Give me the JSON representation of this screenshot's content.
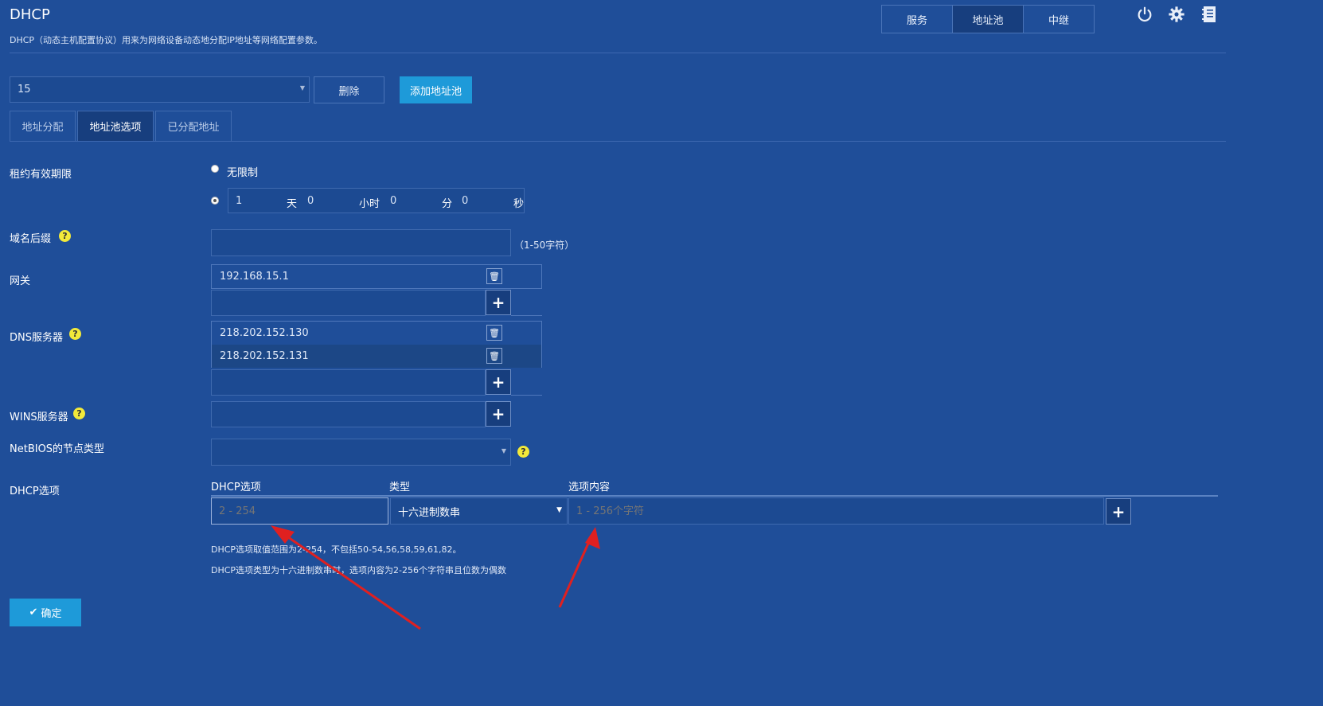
{
  "header": {
    "title": "DHCP",
    "subtitle": "DHCP（动态主机配置协议）用来为网络设备动态地分配IP地址等网络配置参数。",
    "tabs": [
      {
        "label": "服务",
        "active": false
      },
      {
        "label": "地址池",
        "active": true
      },
      {
        "label": "中继",
        "active": false
      }
    ],
    "icons": [
      "power-icon",
      "gear-icon",
      "notebook-icon"
    ]
  },
  "pool": {
    "selected": "15",
    "delete_label": "删除",
    "add_label": "添加地址池"
  },
  "subtabs": [
    {
      "label": "地址分配",
      "active": false
    },
    {
      "label": "地址池选项",
      "active": true
    },
    {
      "label": "已分配地址",
      "active": false
    }
  ],
  "lease": {
    "label": "租约有效期限",
    "unlimited_label": "无限制",
    "days": "1",
    "days_unit": "天",
    "hours": "0",
    "hours_unit": "小时",
    "minutes": "0",
    "minutes_unit": "分",
    "seconds": "0",
    "seconds_unit": "秒"
  },
  "domain": {
    "label": "域名后缀",
    "value": "",
    "hint": "（1-50字符）"
  },
  "gateway": {
    "label": "网关",
    "entries": [
      "192.168.15.1"
    ]
  },
  "dns": {
    "label": "DNS服务器",
    "entries": [
      "218.202.152.130",
      "218.202.152.131"
    ]
  },
  "wins": {
    "label": "WINS服务器"
  },
  "netbios": {
    "label": "NetBIOS的节点类型",
    "selected": ""
  },
  "dhcp_options": {
    "label": "DHCP选项",
    "col_option": "DHCP选项",
    "col_type": "类型",
    "col_content": "选项内容",
    "option_placeholder": "2 - 254",
    "type_selected": "十六进制数串",
    "content_placeholder": "1 - 256个字符",
    "hint1": "DHCP选项取值范围为2-254，不包括50-54,56,58,59,61,82。",
    "hint2": "DHCP选项类型为十六进制数串时，选项内容为2-256个字符串且位数为偶数"
  },
  "confirm_label": "确定",
  "colors": {
    "background": "#1f4e99",
    "primary_button": "#1e9ad9",
    "help_icon": "#f2e93a",
    "arrow": "#e02020"
  }
}
